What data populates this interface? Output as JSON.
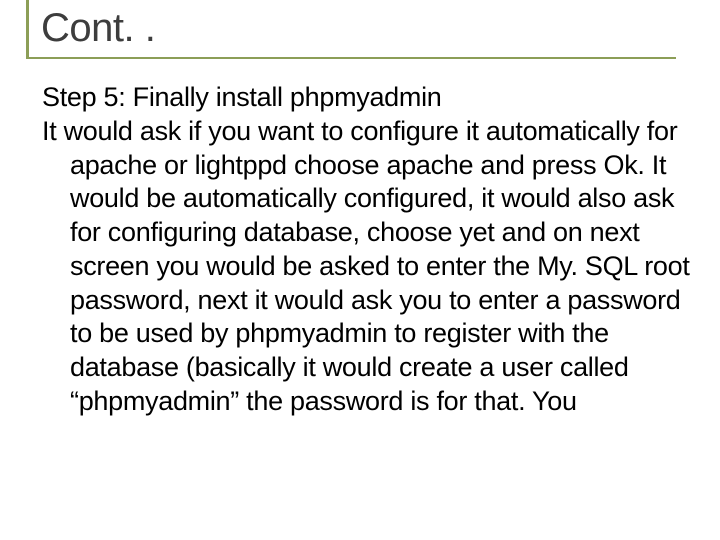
{
  "slide": {
    "title": "Cont. .",
    "step": "Step 5: Finally install phpmyadmin",
    "description": "It would ask if you want to configure it automatically for apache or lightppd choose apache and press Ok. It would be automatically configured, it would also ask for configuring database, choose yet and on next screen you would be asked to enter the My. SQL root password, next it would ask you to enter a password to be used by phpmyadmin to register with the database (basically it would create a user called “phpmyadmin” the password is for that. You"
  }
}
